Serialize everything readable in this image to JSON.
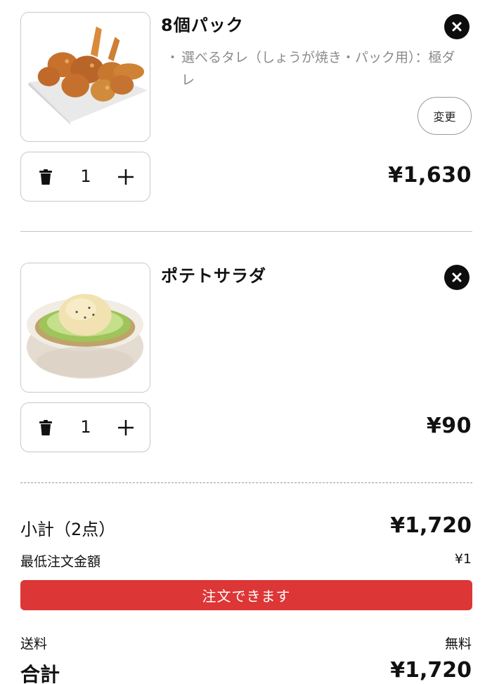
{
  "cart": {
    "items": [
      {
        "name": "8個パック",
        "option_bullet": "・",
        "option": "選べるタレ（しょうが焼き・パック用）：極ダレ",
        "change_label": "変更",
        "quantity": "1",
        "price": "¥1,630"
      },
      {
        "name": "ポテトサラダ",
        "quantity": "1",
        "price": "¥90"
      }
    ]
  },
  "summary": {
    "subtotal_label": "小計（2点）",
    "subtotal_value": "¥1,720",
    "min_order_label": "最低注文金額",
    "min_order_value": "¥1",
    "order_status": "注文できます",
    "shipping_label": "送料",
    "shipping_value": "無料",
    "total_label": "合計",
    "total_value": "¥1,720"
  },
  "colors": {
    "accent": "#dd3636",
    "text": "#111111",
    "muted": "#8a8a8a"
  },
  "icons": {
    "remove": "close-icon",
    "trash": "trash-icon",
    "plus": "plus-icon"
  }
}
